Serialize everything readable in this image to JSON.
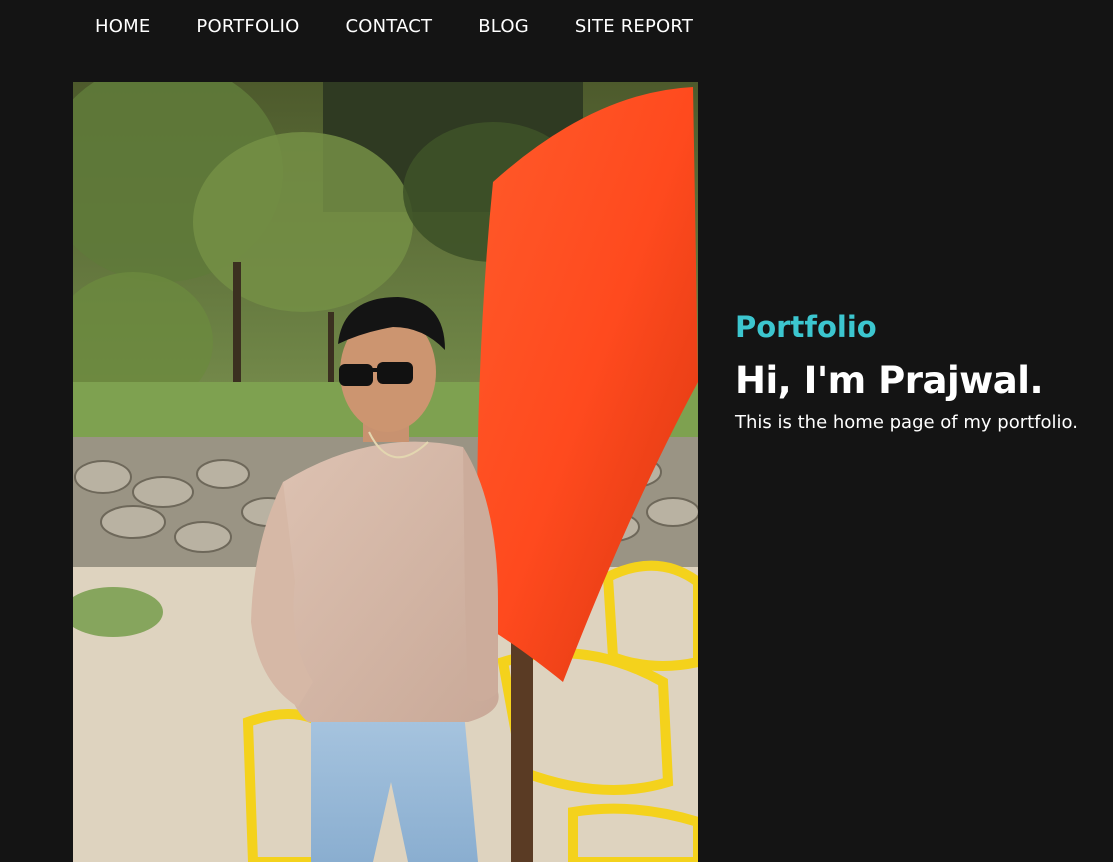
{
  "nav": {
    "items": [
      {
        "label": "HOME"
      },
      {
        "label": "PORTFOLIO"
      },
      {
        "label": "CONTACT"
      },
      {
        "label": "BLOG"
      },
      {
        "label": "SITE REPORT"
      }
    ]
  },
  "hero": {
    "photo_icon": "portrait-photo",
    "colors": {
      "background": "#141414",
      "accent": "#3cc6cf",
      "text": "#ffffff"
    }
  },
  "intro": {
    "kicker": "Portfolio",
    "headline": "Hi, I'm Prajwal.",
    "lede": "This is the home page of my portfolio."
  }
}
